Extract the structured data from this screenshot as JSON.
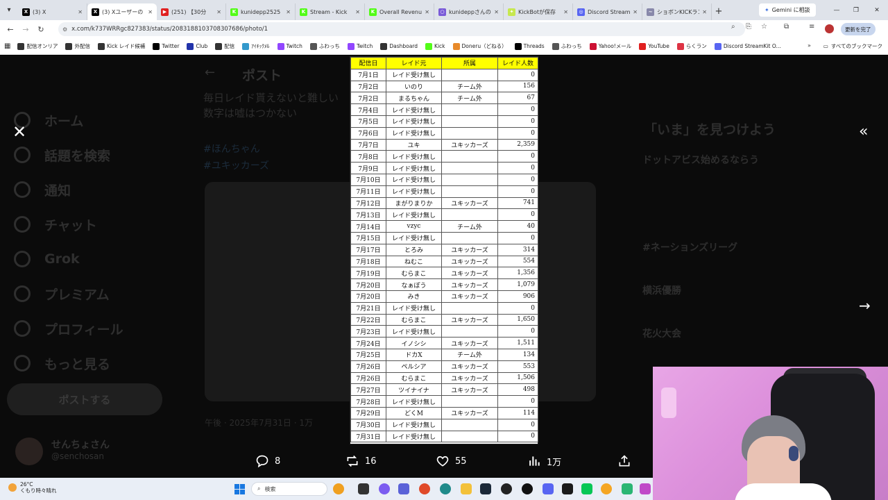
{
  "browser": {
    "tabs": [
      {
        "title": "(3) X",
        "color": "#000000",
        "glyph": "X"
      },
      {
        "title": "(3) Xユーザーの",
        "color": "#000000",
        "glyph": "X",
        "active": true
      },
      {
        "title": "(251) 【30分",
        "color": "#e02020",
        "glyph": "▶"
      },
      {
        "title": "kunidepp2525",
        "color": "#53fc18",
        "glyph": "K"
      },
      {
        "title": "Stream - Kick",
        "color": "#53fc18",
        "glyph": "K"
      },
      {
        "title": "Overall Revenu",
        "color": "#53fc18",
        "glyph": "K"
      },
      {
        "title": "kunideppさんの",
        "color": "#7a5bd8",
        "glyph": "○"
      },
      {
        "title": "KickBotが保存",
        "color": "#c7e84f",
        "glyph": "✦"
      },
      {
        "title": "Discord Stream",
        "color": "#5865f2",
        "glyph": "◎"
      },
      {
        "title": "ショボンKICKラン",
        "color": "#8888aa",
        "glyph": "~"
      }
    ],
    "gemini_label": "Gemini に相談",
    "url": "x.com/k737WRRgc827383/status/2083188103708307686/photo/1",
    "update_label": "更新を完了",
    "bookmarks": [
      {
        "label": "配信オンリア",
        "color": "#333"
      },
      {
        "label": "外配信",
        "color": "#333"
      },
      {
        "label": "Kick レイド候補",
        "color": "#333"
      },
      {
        "label": "Twitter",
        "color": "#000"
      },
      {
        "label": "Club",
        "color": "#2233aa"
      },
      {
        "label": "配信",
        "color": "#333"
      },
      {
        "label": "ｱｲｷｯｸﾒﾙ",
        "color": "#3399cc"
      },
      {
        "label": "Twitch",
        "color": "#9146ff"
      },
      {
        "label": "ふわっち",
        "color": "#555"
      },
      {
        "label": "Twitch",
        "color": "#9146ff"
      },
      {
        "label": "Dashboard",
        "color": "#333"
      },
      {
        "label": "Kick",
        "color": "#53fc18"
      },
      {
        "label": "Doneru（どねる）",
        "color": "#e88a2a"
      },
      {
        "label": "Threads",
        "color": "#000"
      },
      {
        "label": "ふわっち",
        "color": "#555"
      },
      {
        "label": "Yahoo!メール",
        "color": "#cc1133"
      },
      {
        "label": "YouTube",
        "color": "#e02020"
      },
      {
        "label": "らくラン",
        "color": "#dd3344"
      },
      {
        "label": "Discord StreamKit O...",
        "color": "#5865f2"
      }
    ],
    "all_bookmarks_label": "すべてのブックマーク"
  },
  "background": {
    "nav": [
      "ホーム",
      "話題を検索",
      "通知",
      "チャット",
      "Grok",
      "プレミアム",
      "プロフィール",
      "もっと見る"
    ],
    "post_button": "ポストする",
    "user_name": "せんちょさん",
    "user_handle": "@senchosan",
    "page_title": "ポスト",
    "post_text_1": "毎日レイド貰えないと難しい",
    "post_text_2": "数字は嘘はつかない",
    "hashtag_1": "#ほんちゃん",
    "hashtag_2": "#ユキッカーズ",
    "post_meta": "午後 · 2025年7月31日 · 1万",
    "right_heading": "「いま」を見つけよう",
    "right_item_1": "ドットアビス始めるならう",
    "right_item_2": "#ネーションズリーグ",
    "right_item_3": "横浜優勝",
    "right_item_4": "花火大会"
  },
  "sheet": {
    "headers": [
      "配信日",
      "レイド元",
      "所属",
      "レイド人数"
    ],
    "rows": [
      [
        "7月1日",
        "レイド受け無し",
        "",
        "0"
      ],
      [
        "7月2日",
        "いのり",
        "チーム外",
        "156"
      ],
      [
        "7月2日",
        "まるちゃん",
        "チーム外",
        "67"
      ],
      [
        "7月4日",
        "レイド受け無し",
        "",
        "0"
      ],
      [
        "7月5日",
        "レイド受け無し",
        "",
        "0"
      ],
      [
        "7月6日",
        "レイド受け無し",
        "",
        "0"
      ],
      [
        "7月7日",
        "ユキ",
        "ユキッカーズ",
        "2,359"
      ],
      [
        "7月8日",
        "レイド受け無し",
        "",
        "0"
      ],
      [
        "7月9日",
        "レイド受け無し",
        "",
        "0"
      ],
      [
        "7月10日",
        "レイド受け無し",
        "",
        "0"
      ],
      [
        "7月11日",
        "レイド受け無し",
        "",
        "0"
      ],
      [
        "7月12日",
        "まがりまりか",
        "ユキッカーズ",
        "741"
      ],
      [
        "7月13日",
        "レイド受け無し",
        "",
        "0"
      ],
      [
        "7月14日",
        "vzyc",
        "チーム外",
        "40"
      ],
      [
        "7月15日",
        "レイド受け無し",
        "",
        "0"
      ],
      [
        "7月17日",
        "とろみ",
        "ユキッカーズ",
        "314"
      ],
      [
        "7月18日",
        "ねむこ",
        "ユキッカーズ",
        "554"
      ],
      [
        "7月19日",
        "むらまこ",
        "ユキッカーズ",
        "1,356"
      ],
      [
        "7月20日",
        "なぁぽう",
        "ユキッカーズ",
        "1,079"
      ],
      [
        "7月20日",
        "みき",
        "ユキッカーズ",
        "906"
      ],
      [
        "7月21日",
        "レイド受け無し",
        "",
        "0"
      ],
      [
        "7月22日",
        "むらまこ",
        "ユキッカーズ",
        "1,650"
      ],
      [
        "7月23日",
        "レイド受け無し",
        "",
        "0"
      ],
      [
        "7月24日",
        "イノシシ",
        "ユキッカーズ",
        "1,511"
      ],
      [
        "7月25日",
        "ドカX",
        "チーム外",
        "134"
      ],
      [
        "7月26日",
        "ペルシア",
        "ユキッカーズ",
        "553"
      ],
      [
        "7月26日",
        "むらまこ",
        "ユキッカーズ",
        "1,506"
      ],
      [
        "7月27日",
        "ツイナイナ",
        "ユキッカーズ",
        "498"
      ],
      [
        "7月28日",
        "レイド受け無し",
        "",
        "0"
      ],
      [
        "7月29日",
        "どくM",
        "ユキッカーズ",
        "114"
      ],
      [
        "7月30日",
        "レイド受け無し",
        "",
        "0"
      ],
      [
        "7月31日",
        "レイド受け無し",
        "",
        "0"
      ]
    ]
  },
  "actions": {
    "reply_count": "8",
    "repost_count": "16",
    "like_count": "55",
    "view_count": "1万"
  },
  "taskbar": {
    "temperature": "26°C",
    "weather_text": "くもり時々晴れ",
    "search_placeholder": "検索"
  }
}
